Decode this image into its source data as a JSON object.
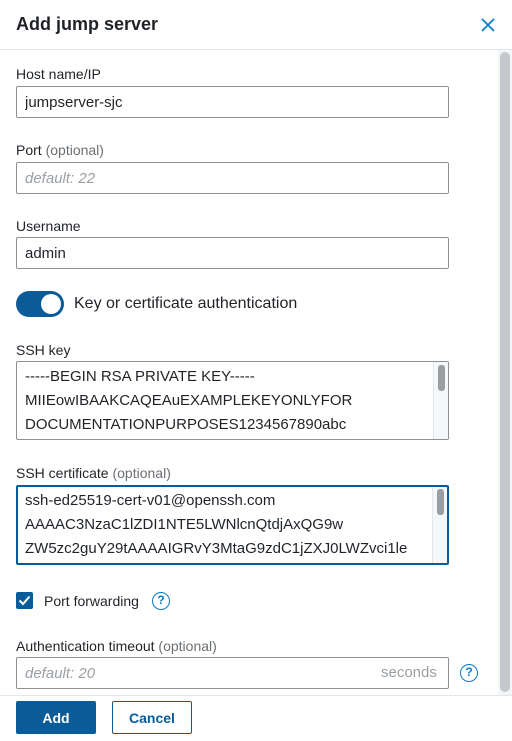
{
  "dialog": {
    "title": "Add jump server",
    "close_icon": "close-icon"
  },
  "host": {
    "label": "Host name/IP",
    "value": "jumpserver-sjc"
  },
  "port": {
    "label": "Port",
    "optional": "(optional)",
    "placeholder": "default: 22"
  },
  "username": {
    "label": "Username",
    "value": "admin"
  },
  "auth_toggle": {
    "label": "Key or certificate authentication",
    "on": true
  },
  "ssh_key": {
    "label": "SSH key",
    "lines": [
      "-----BEGIN RSA PRIVATE KEY-----",
      "MIIEowIBAAKCAQEAuEXAMPLEKEYONLYFOR",
      "DOCUMENTATIONPURPOSES1234567890abc"
    ]
  },
  "ssh_cert": {
    "label": "SSH certificate",
    "optional": "(optional)",
    "lines": [
      "ssh-ed25519-cert-v01@openssh.com",
      "AAAAC3NzaC1lZDI1NTE5LWNlcnQtdjAxQG9w",
      "ZW5zc2guY29tAAAAIGRvY3MtaG9zdC1jZXJ0LWZvci1le"
    ]
  },
  "port_forwarding": {
    "label": "Port forwarding",
    "checked": true
  },
  "timeout": {
    "label": "Authentication timeout",
    "optional": "(optional)",
    "placeholder": "default: 20",
    "suffix": "seconds"
  },
  "footer": {
    "add_label": "Add",
    "cancel_label": "Cancel"
  },
  "colors": {
    "accent": "#0a5c99",
    "help": "#0a7cc1"
  }
}
